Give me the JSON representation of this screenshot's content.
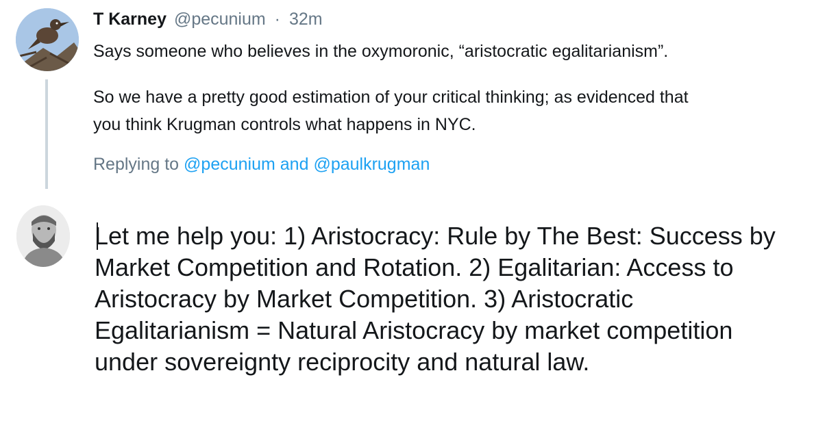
{
  "tweet": {
    "author_name": "T Karney",
    "author_handle": "@pecunium",
    "separator": "·",
    "time": "32m",
    "lines": [
      "Says someone who believes in the oxymoronic, “aristocratic egalitarianism”.",
      "So we have a pretty good estimation of your critical thinking; as evidenced that",
      "you think Krugman controls what happens in NYC."
    ],
    "avatar_icon": "bird-avatar-icon"
  },
  "reply_context": {
    "prefix": "Replying to",
    "mention_1": "@pecunium",
    "conjunction": "and",
    "mention_2": "@paulkrugman"
  },
  "composer": {
    "avatar_icon": "user-avatar-icon",
    "lines": [
      "Let me help you: 1) Aristocracy: Rule by The Best: Success by",
      "Market Competition and Rotation. 2) Egalitarian: Access to",
      "Aristocracy by Market Competition. 3) Aristocratic",
      "Egalitarianism = Natural Aristocracy by market competition",
      "under sovereignty reciprocity and natural law."
    ]
  },
  "colors": {
    "link": "#1da1f2",
    "secondary_text": "#657786",
    "primary_text": "#14171a",
    "thread_line": "#ccd6dd"
  }
}
